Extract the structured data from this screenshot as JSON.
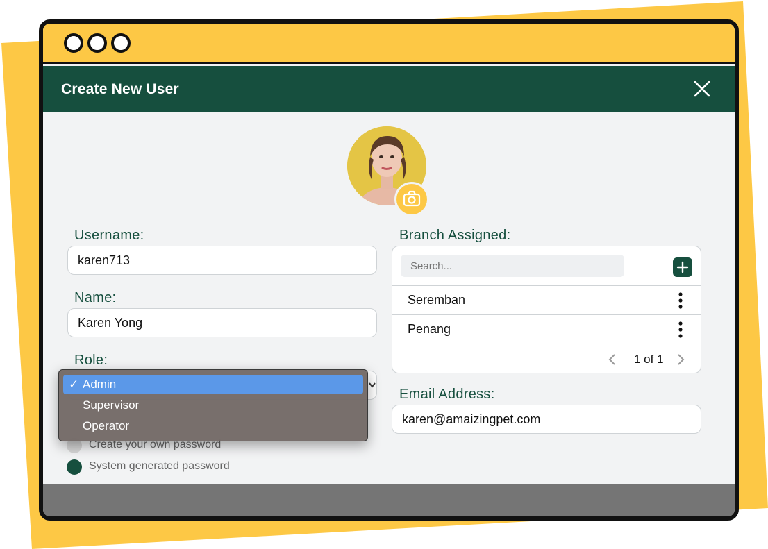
{
  "dialog": {
    "title": "Create New User",
    "fields": {
      "username": {
        "label": "Username:",
        "value": "karen713"
      },
      "name": {
        "label": "Name:",
        "value": "Karen Yong"
      },
      "role": {
        "label": "Role:"
      },
      "email": {
        "label": "Email Address:",
        "value": "karen@amaizingpet.com"
      }
    },
    "branch": {
      "label": "Branch Assigned:",
      "search_placeholder": "Search...",
      "items": [
        "Seremban",
        "Penang"
      ],
      "pager": "1 of 1"
    },
    "role_dropdown": {
      "options": [
        "Admin",
        "Supervisor",
        "Operator"
      ],
      "selected": "Admin",
      "check": "✓"
    },
    "password_options": [
      {
        "label": "Create your own password",
        "checked": false
      },
      {
        "label": "System generated password",
        "checked": true
      }
    ]
  },
  "colors": {
    "brand_green": "#164f3e",
    "accent_yellow": "#fdc845",
    "select_blue": "#5b98e8"
  }
}
